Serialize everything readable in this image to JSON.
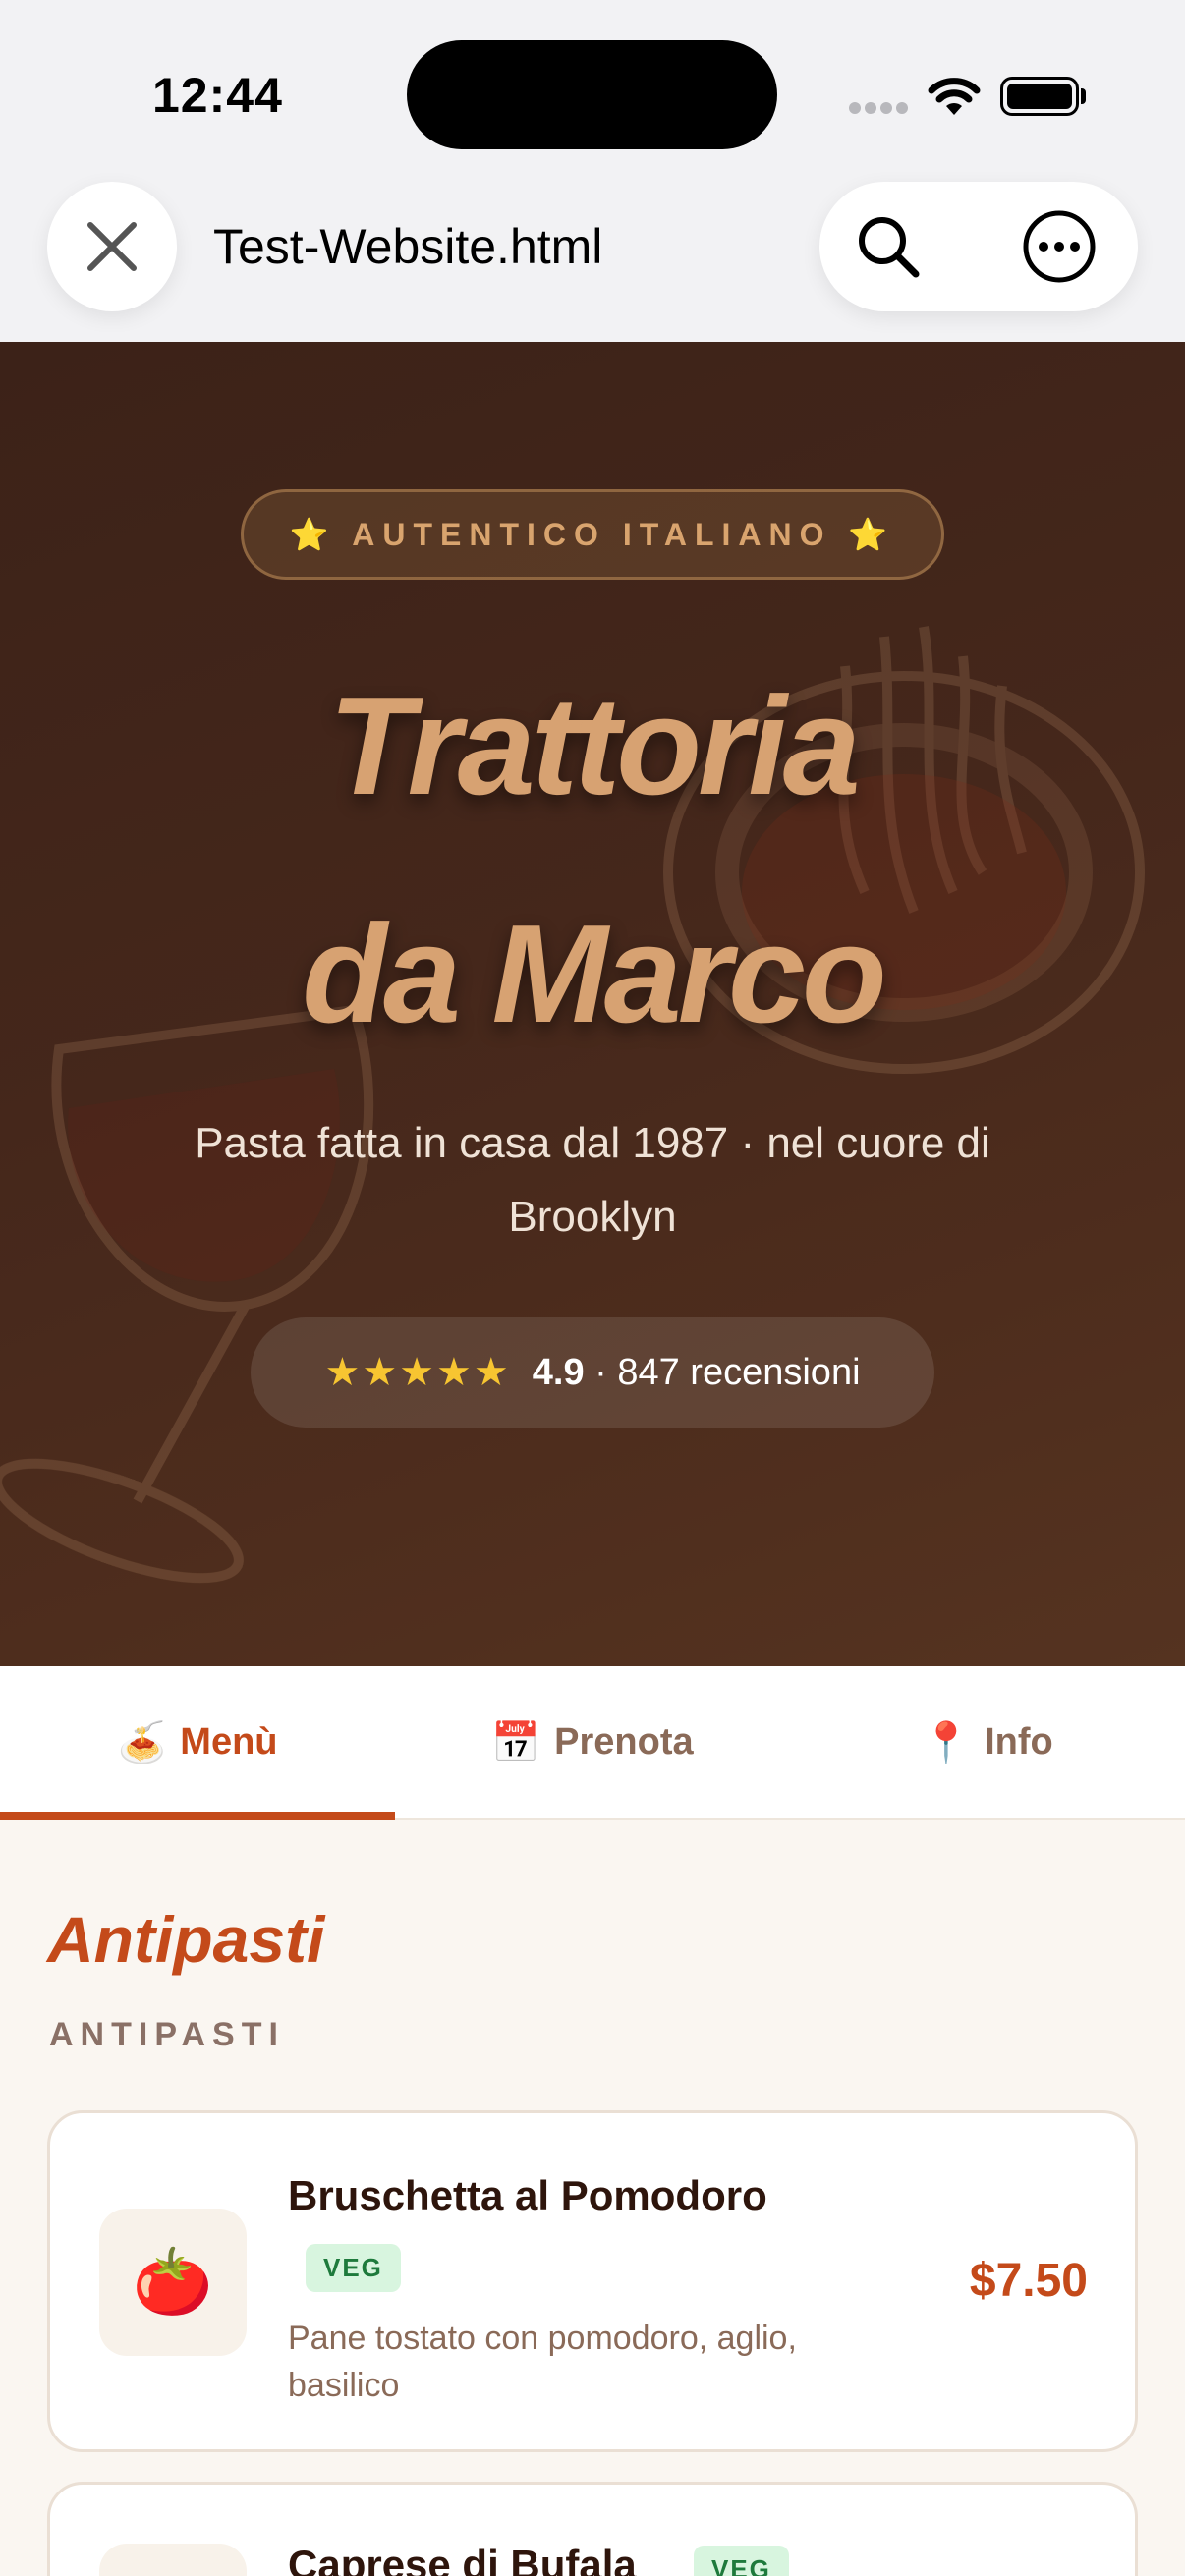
{
  "status_bar": {
    "time": "12:44"
  },
  "browser": {
    "page_title": "Test-Website.html"
  },
  "hero": {
    "badge": "⭐ AUTENTICO ITALIANO ⭐",
    "title_line1": "Trattoria",
    "title_line2": "da Marco",
    "subtitle": "Pasta fatta in casa dal 1987 · nel cuore di Brooklyn",
    "rating_stars": "★★★★★",
    "rating_value": "4.9",
    "rating_count": "· 847 recensioni"
  },
  "tabs": [
    {
      "icon": "🍝",
      "label": "Menù",
      "active": true
    },
    {
      "icon": "📅",
      "label": "Prenota",
      "active": false
    },
    {
      "icon": "📍",
      "label": "Info",
      "active": false
    }
  ],
  "menu": {
    "section_title": "Antipasti",
    "section_subtitle": "ANTIPASTI",
    "items": [
      {
        "emoji": "🍅",
        "name": "Bruschetta al Pomodoro",
        "tag": "VEG",
        "description": "Pane tostato con pomodoro, aglio, basilico",
        "price": "$7.50"
      },
      {
        "emoji": "🧀",
        "name": "Caprese di Bufala",
        "tag": "VEG",
        "description": "",
        "price": ""
      }
    ]
  },
  "colors": {
    "accent": "#c44a1a",
    "hero_title": "#d7a272",
    "hero_bg": "#45271b",
    "star": "#f7c531",
    "veg_bg": "#d8f5df",
    "veg_text": "#1e7a3c"
  }
}
